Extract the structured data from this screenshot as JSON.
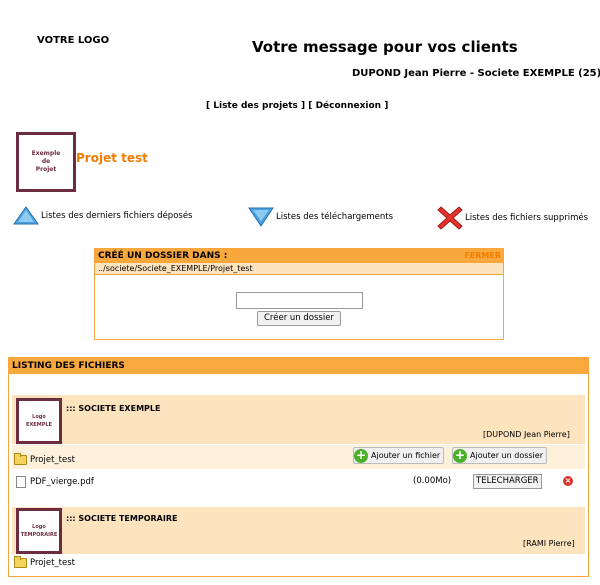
{
  "header": {
    "logo": "VOTRE LOGO",
    "message": "Votre message pour vos clients",
    "user": "DUPOND Jean Pierre - Societe EXEMPLE (25)"
  },
  "nav": {
    "open1": "[ ",
    "projects": "Liste des projets",
    "mid": " ]  [ ",
    "logout": "Déconnexion",
    "close1": " ]"
  },
  "project": {
    "thumb_line1": "Exemple",
    "thumb_line2": "de",
    "thumb_line3": "Projet",
    "title": "Projet test"
  },
  "legend": {
    "uploaded": "Listes des derniers fichiers déposés",
    "downloads": "Listes des téléchargements",
    "deleted": "Listes des fichiers supprimés"
  },
  "create_folder": {
    "title": "CRÉÉ UN DOSSIER DANS :",
    "close": "FERMER",
    "path": "../societe/Societe_EXEMPLE/Projet_test",
    "input_value": "",
    "button": "Créer un dossier"
  },
  "listing": {
    "title": "LISTING DES FICHIERS",
    "companies": [
      {
        "logo_line1": "Logo",
        "logo_line2": "EXEMPLE",
        "name": "::: SOCIETE EXEMPLE",
        "owner": "[DUPOND Jean Pierre]",
        "folder": "Projet_test",
        "add_file": "Ajouter un fichier",
        "add_folder": "Ajouter un dossier",
        "file_name": "PDF_vierge.pdf",
        "file_size": "(0.00Mo)",
        "download": "TELECHARGER"
      },
      {
        "logo_line1": "Logo",
        "logo_line2": "TEMPORAIRE",
        "name": "::: SOCIETE TEMPORAIRE",
        "owner": "[RAMI Pierre]",
        "folder": "Projet_test"
      }
    ]
  },
  "colors": {
    "orange": "#f9a83e",
    "light_orange": "#fde4bf",
    "title_orange": "#f07d00",
    "frame": "#6b2d3e"
  }
}
